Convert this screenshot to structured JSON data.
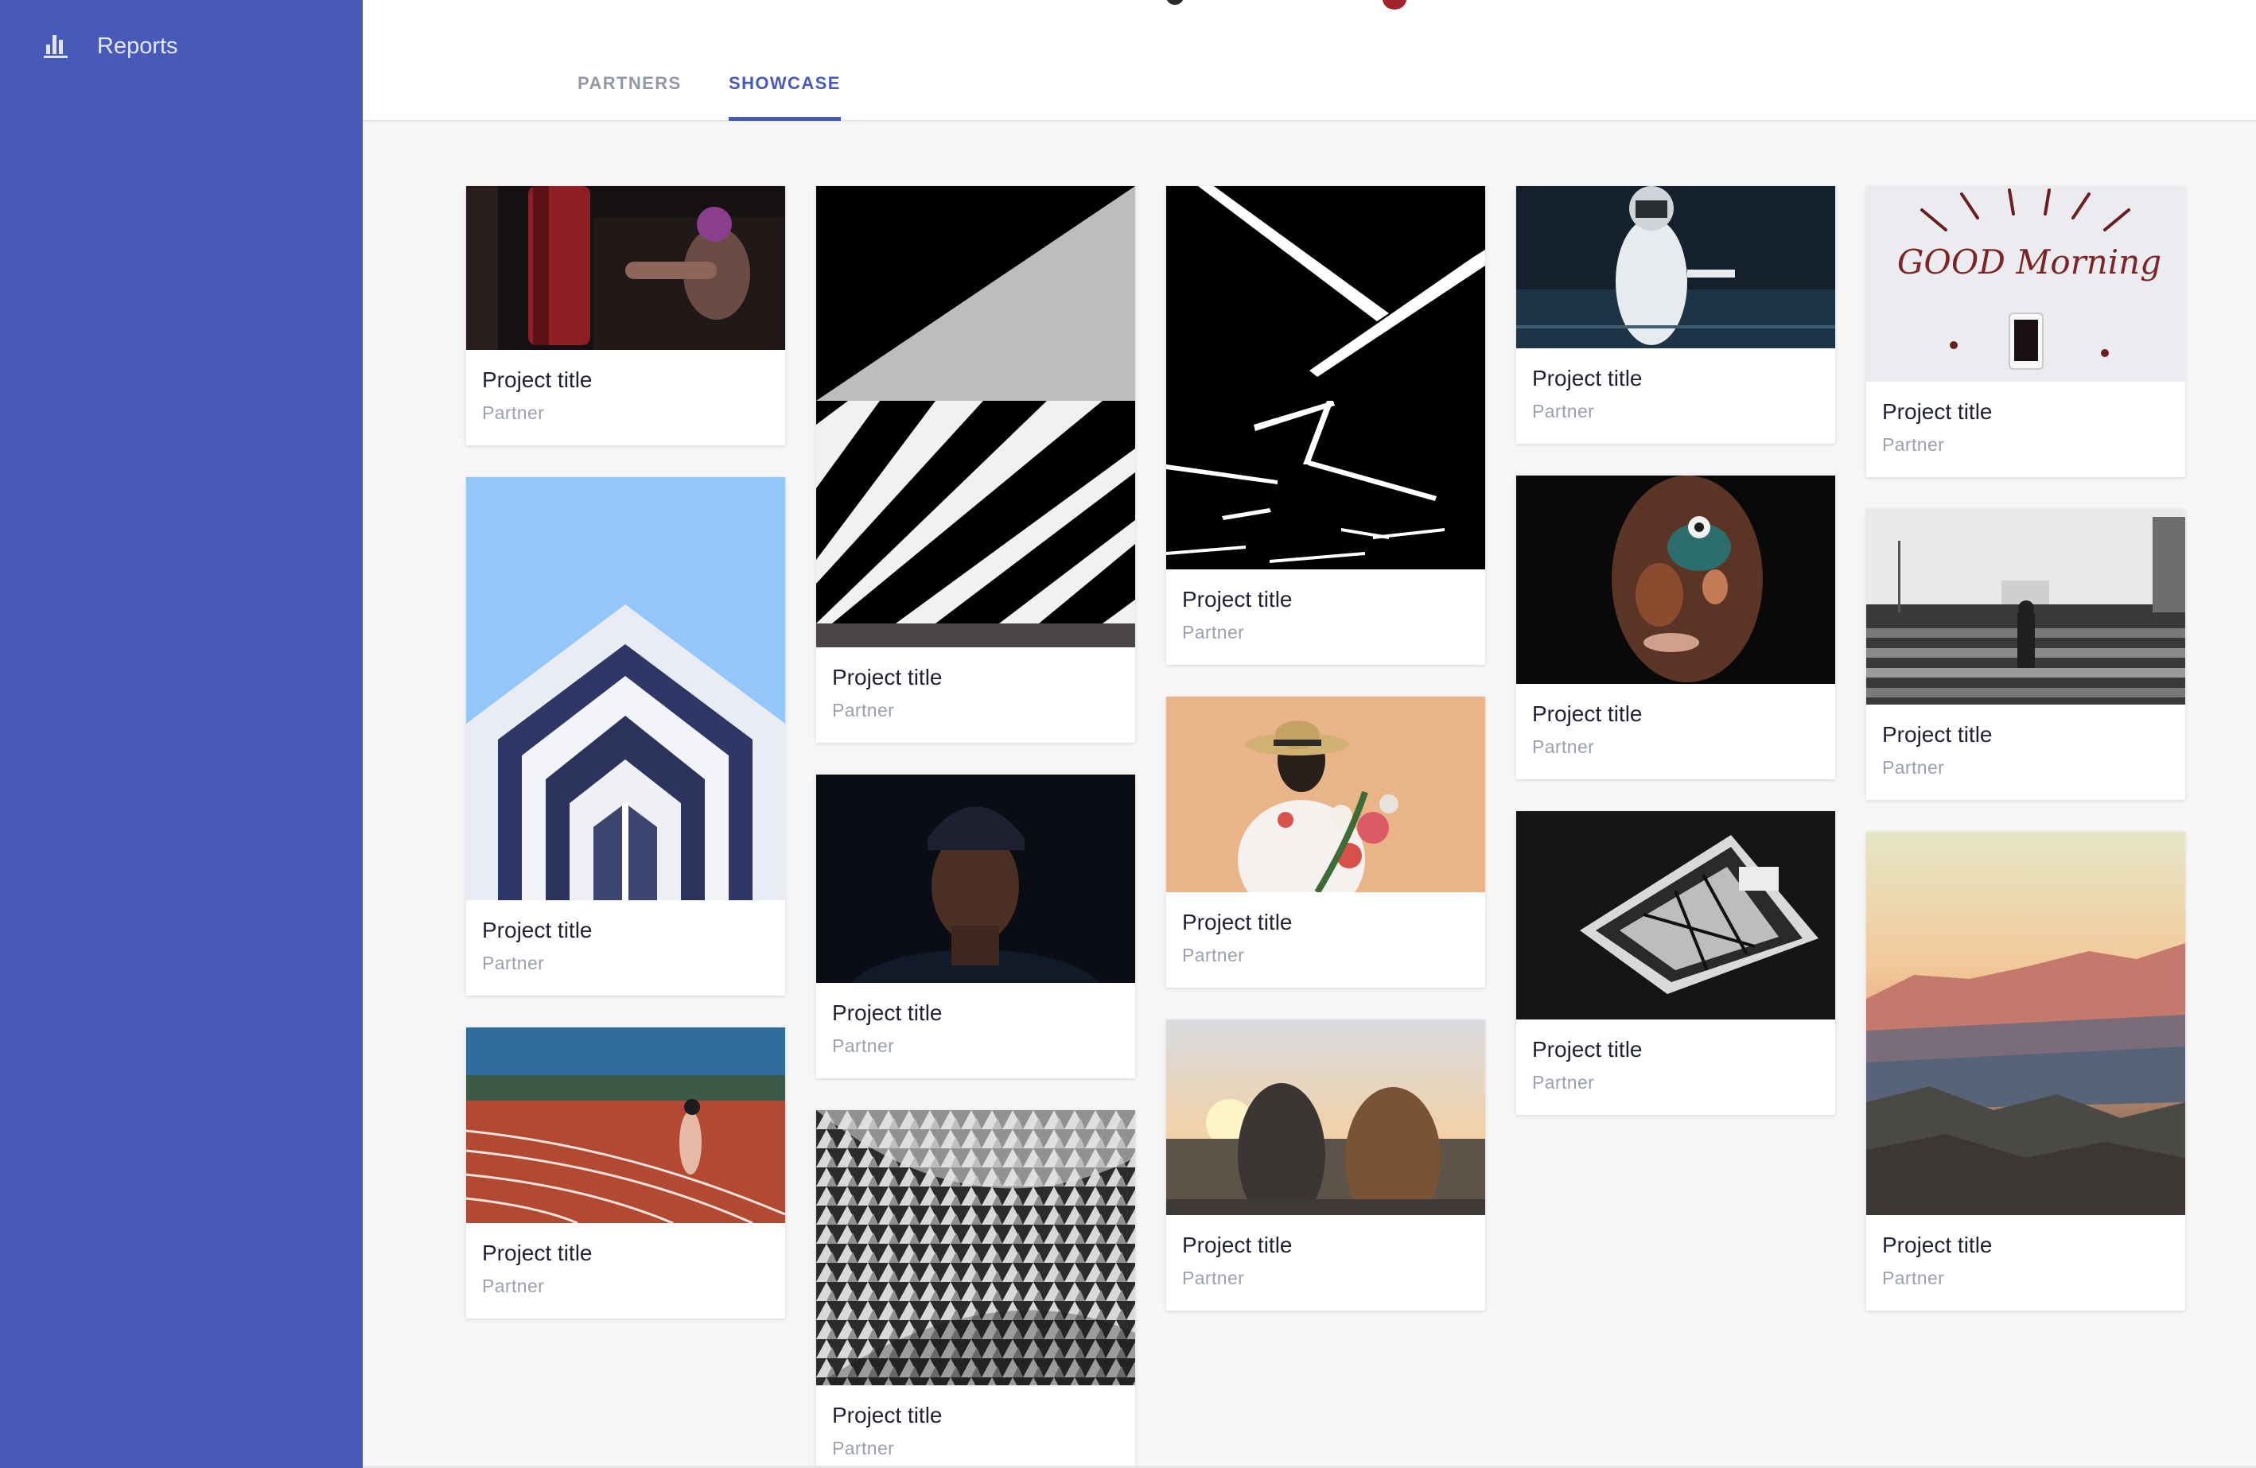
{
  "sidebar": {
    "items": [
      {
        "label": "Reports",
        "icon": "bar-chart-icon"
      }
    ],
    "background": "#4759b9"
  },
  "tabs": [
    {
      "label": "PARTNERS",
      "active": false
    },
    {
      "label": "SHOWCASE",
      "active": true
    }
  ],
  "accent_color": "#4759b9",
  "cards": [
    {
      "title": "Project title",
      "subtitle": "Partner",
      "image": "boxer-hitting-heavy-bag"
    },
    {
      "title": "Project title",
      "subtitle": "Partner",
      "image": "modern-building-against-blue-sky"
    },
    {
      "title": "Project title",
      "subtitle": "Partner",
      "image": "sprinter-on-running-track"
    },
    {
      "title": "Project title",
      "subtitle": "Partner",
      "image": "black-white-diagonal-stripes-concrete"
    },
    {
      "title": "Project title",
      "subtitle": "Partner",
      "image": "man-in-cap-portrait-dark"
    },
    {
      "title": "Project title",
      "subtitle": "Partner",
      "image": "silver-triangular-facade-pattern"
    },
    {
      "title": "Project title",
      "subtitle": "Partner",
      "image": "light-streaks-on-black-ceiling"
    },
    {
      "title": "Project title",
      "subtitle": "Partner",
      "image": "woman-in-hat-holding-flowers"
    },
    {
      "title": "Project title",
      "subtitle": "Partner",
      "image": "two-women-watching-sunset-city"
    },
    {
      "title": "Project title",
      "subtitle": "Partner",
      "image": "fencer-in-white-uniform"
    },
    {
      "title": "Project title",
      "subtitle": "Partner",
      "image": "man-with-painted-face"
    },
    {
      "title": "Project title",
      "subtitle": "Partner",
      "image": "glass-skylight-black-white"
    },
    {
      "title": "Project title",
      "subtitle": "Partner",
      "image": "good-morning-coffee-beans-phone",
      "image_text": "GOOD Morning"
    },
    {
      "title": "Project title",
      "subtitle": "Partner",
      "image": "person-standing-in-stadium-bw"
    },
    {
      "title": "Project title",
      "subtitle": "Partner",
      "image": "desert-mountains-at-sunset"
    }
  ]
}
